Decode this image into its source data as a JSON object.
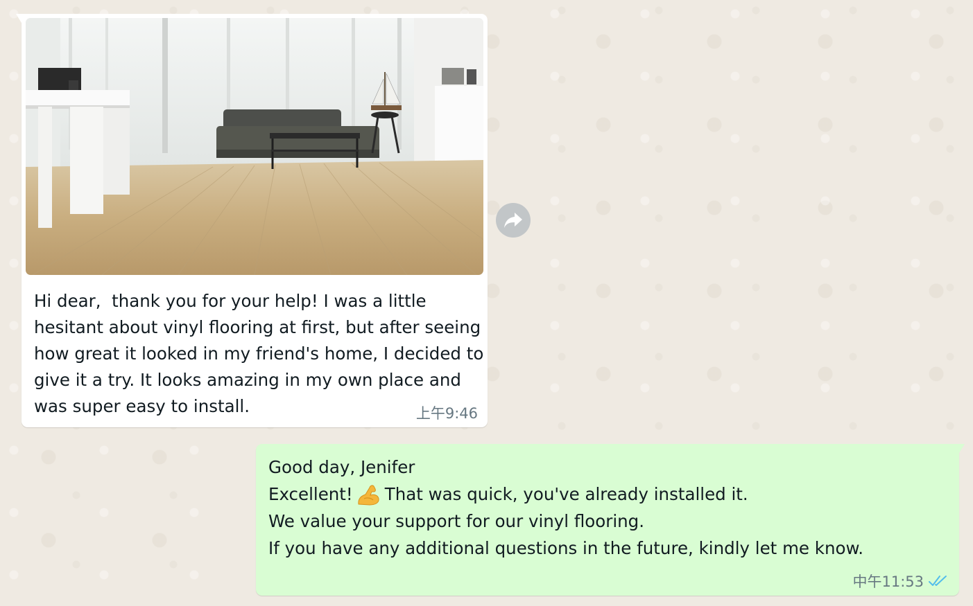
{
  "incoming": {
    "image_alt": "Living room with vinyl plank flooring, grey sofa, glass coffee table and white desk",
    "text": "Hi dear,  thank you for your help! I was a little hesitant about vinyl flooring at first, but after seeing how great it looked in my friend's home, I decided to give it a try. It looks amazing in my own place and was super easy to install.",
    "time": "上午9:46"
  },
  "forward_icon": "share-arrow-icon",
  "outgoing": {
    "line1": "Good day, Jenifer",
    "line2_before": "Excellent! ",
    "line2_emoji": "flexed-biceps-emoji",
    "line2_after": "That was quick, you've already installed it.",
    "line3": "We value your support for our vinyl flooring.",
    "line4": "If you have any additional questions in the future, kindly let me know.",
    "time": "中午11:53",
    "status_icon": "double-check-read-icon"
  },
  "colors": {
    "chat_background": "#efeae2",
    "incoming_bubble": "#ffffff",
    "outgoing_bubble": "#d9fdd3",
    "timestamp": "#667781",
    "read_ticks": "#53bdeb"
  }
}
